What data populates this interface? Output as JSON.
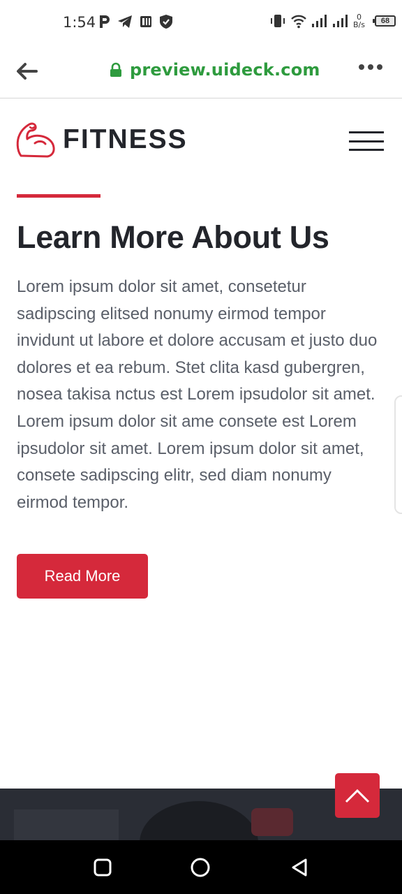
{
  "status_bar": {
    "time": "1:54",
    "left_icons": [
      "p-icon",
      "telegram-icon",
      "pdf-icon",
      "shield-icon"
    ],
    "net_speed_value": "0",
    "net_speed_unit": "B/s",
    "battery": "68"
  },
  "browser": {
    "url": "preview.uideck.com",
    "secure": true
  },
  "header": {
    "logo_text": "FITNESS"
  },
  "about": {
    "title": "Learn More About Us",
    "body": "Lorem ipsum dolor sit amet, consetetur sadipscing elitsed nonumy eirmod tempor invidunt ut labore et dolore accusam et justo duo dolores et ea rebum. Stet clita kasd gubergren, nosea takisa nctus est Lorem ipsudolor sit amet. Lorem ipsum dolor sit ame consete est Lorem ipsudolor sit amet. Lorem ipsum dolor sit amet, consete sadipscing elitr, sed diam nonumy eirmod tempor.",
    "button_label": "Read More"
  },
  "colors": {
    "accent": "#d5293b",
    "heading": "#23252b",
    "body_text": "#5a5f69",
    "url_green": "#2e9b3e"
  }
}
